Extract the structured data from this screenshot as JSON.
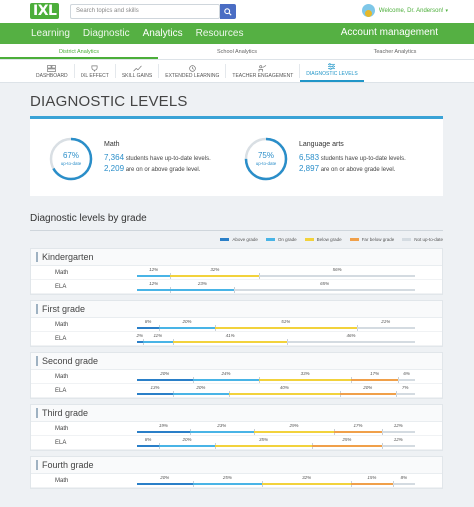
{
  "header": {
    "logo": "IXL",
    "search_placeholder": "Search topics and skills",
    "user_greeting": "Welcome, Dr. Anderson!",
    "user_caret": "▾"
  },
  "main_nav": {
    "items": [
      "Learning",
      "Diagnostic",
      "Analytics",
      "Resources"
    ],
    "active": "Analytics",
    "account": "Account management"
  },
  "sub_nav": {
    "items": [
      "District Analytics",
      "School Analytics",
      "Teacher Analytics"
    ],
    "active": "District Analytics"
  },
  "tabs": {
    "items": [
      "DASHBOARD",
      "IXL EFFECT",
      "SKILL GAINS",
      "EXTENDED LEARNING",
      "TEACHER ENGAGEMENT",
      "DIAGNOSTIC LEVELS"
    ],
    "active": "DIAGNOSTIC LEVELS"
  },
  "page": {
    "title": "DIAGNOSTIC LEVELS",
    "section_title": "Diagnostic levels by grade"
  },
  "summary": [
    {
      "percent": 67,
      "percent_label": "67%",
      "sub": "up-to-date",
      "subject": "Math",
      "count1": "7,364",
      "text1": "students have up-to-date levels.",
      "count2": "2,209",
      "text2": "are on or above grade level."
    },
    {
      "percent": 75,
      "percent_label": "75%",
      "sub": "up-to-date",
      "subject": "Language arts",
      "count1": "6,583",
      "text1": "students have up-to-date levels.",
      "count2": "2,897",
      "text2": "are on or above grade level."
    }
  ],
  "legend": [
    {
      "label": "Above grade",
      "color": "#3da0d8"
    },
    {
      "label": "On grade",
      "color": "#3da0d8"
    },
    {
      "label": "Below grade",
      "color": "#f2d23c"
    },
    {
      "label": "Far below grade",
      "color": "#f0a04a"
    },
    {
      "label": "Not up-to-date",
      "color": "#d4dbe1"
    }
  ],
  "colors": {
    "above": "#2a7fc8",
    "on": "#49b4e6",
    "below": "#f2d23c",
    "far": "#f0a04a",
    "none": "#d4dbe1",
    "accent_green": "#55b043",
    "accent_blue": "#2196c8"
  },
  "grades": [
    {
      "name": "Kindergarten",
      "rows": [
        {
          "subject": "Math",
          "segments": [
            {
              "type": "on",
              "value": 12,
              "label": "12%"
            },
            {
              "type": "below",
              "value": 32,
              "label": "32%"
            },
            {
              "type": "none",
              "value": 56,
              "label": "56%"
            }
          ]
        },
        {
          "subject": "ELA",
          "segments": [
            {
              "type": "on",
              "value": 12,
              "label": "12%"
            },
            {
              "type": "on",
              "value": 23,
              "label": "23%"
            },
            {
              "type": "none",
              "value": 65,
              "label": "65%"
            }
          ]
        }
      ]
    },
    {
      "name": "First grade",
      "rows": [
        {
          "subject": "Math",
          "segments": [
            {
              "type": "above",
              "value": 8,
              "label": "8%"
            },
            {
              "type": "on",
              "value": 20,
              "label": "20%"
            },
            {
              "type": "below",
              "value": 51,
              "label": "51%"
            },
            {
              "type": "none",
              "value": 21,
              "label": "21%"
            }
          ]
        },
        {
          "subject": "ELA",
          "segments": [
            {
              "type": "above",
              "value": 2,
              "label": "2%"
            },
            {
              "type": "on",
              "value": 11,
              "label": "11%"
            },
            {
              "type": "below",
              "value": 41,
              "label": "41%"
            },
            {
              "type": "none",
              "value": 46,
              "label": "46%"
            }
          ]
        }
      ]
    },
    {
      "name": "Second grade",
      "rows": [
        {
          "subject": "Math",
          "segments": [
            {
              "type": "above",
              "value": 20,
              "label": "20%"
            },
            {
              "type": "on",
              "value": 24,
              "label": "24%"
            },
            {
              "type": "below",
              "value": 33,
              "label": "33%"
            },
            {
              "type": "far",
              "value": 17,
              "label": "17%"
            },
            {
              "type": "none",
              "value": 6,
              "label": "6%"
            }
          ]
        },
        {
          "subject": "ELA",
          "segments": [
            {
              "type": "above",
              "value": 13,
              "label": "13%"
            },
            {
              "type": "on",
              "value": 20,
              "label": "20%"
            },
            {
              "type": "below",
              "value": 40,
              "label": "40%"
            },
            {
              "type": "far",
              "value": 20,
              "label": "20%"
            },
            {
              "type": "none",
              "value": 7,
              "label": "7%"
            }
          ]
        }
      ]
    },
    {
      "name": "Third grade",
      "rows": [
        {
          "subject": "Math",
          "segments": [
            {
              "type": "above",
              "value": 19,
              "label": "19%"
            },
            {
              "type": "on",
              "value": 23,
              "label": "23%"
            },
            {
              "type": "below",
              "value": 29,
              "label": "29%"
            },
            {
              "type": "far",
              "value": 17,
              "label": "17%"
            },
            {
              "type": "none",
              "value": 12,
              "label": "12%"
            }
          ]
        },
        {
          "subject": "ELA",
          "segments": [
            {
              "type": "above",
              "value": 8,
              "label": "8%"
            },
            {
              "type": "on",
              "value": 20,
              "label": "20%"
            },
            {
              "type": "below",
              "value": 35,
              "label": "35%"
            },
            {
              "type": "far",
              "value": 25,
              "label": "25%"
            },
            {
              "type": "none",
              "value": 12,
              "label": "12%"
            }
          ]
        }
      ]
    },
    {
      "name": "Fourth grade",
      "rows": [
        {
          "subject": "Math",
          "segments": [
            {
              "type": "above",
              "value": 20,
              "label": "20%"
            },
            {
              "type": "on",
              "value": 25,
              "label": "25%"
            },
            {
              "type": "below",
              "value": 32,
              "label": "32%"
            },
            {
              "type": "far",
              "value": 15,
              "label": "15%"
            },
            {
              "type": "none",
              "value": 8,
              "label": "8%"
            }
          ]
        }
      ]
    }
  ]
}
